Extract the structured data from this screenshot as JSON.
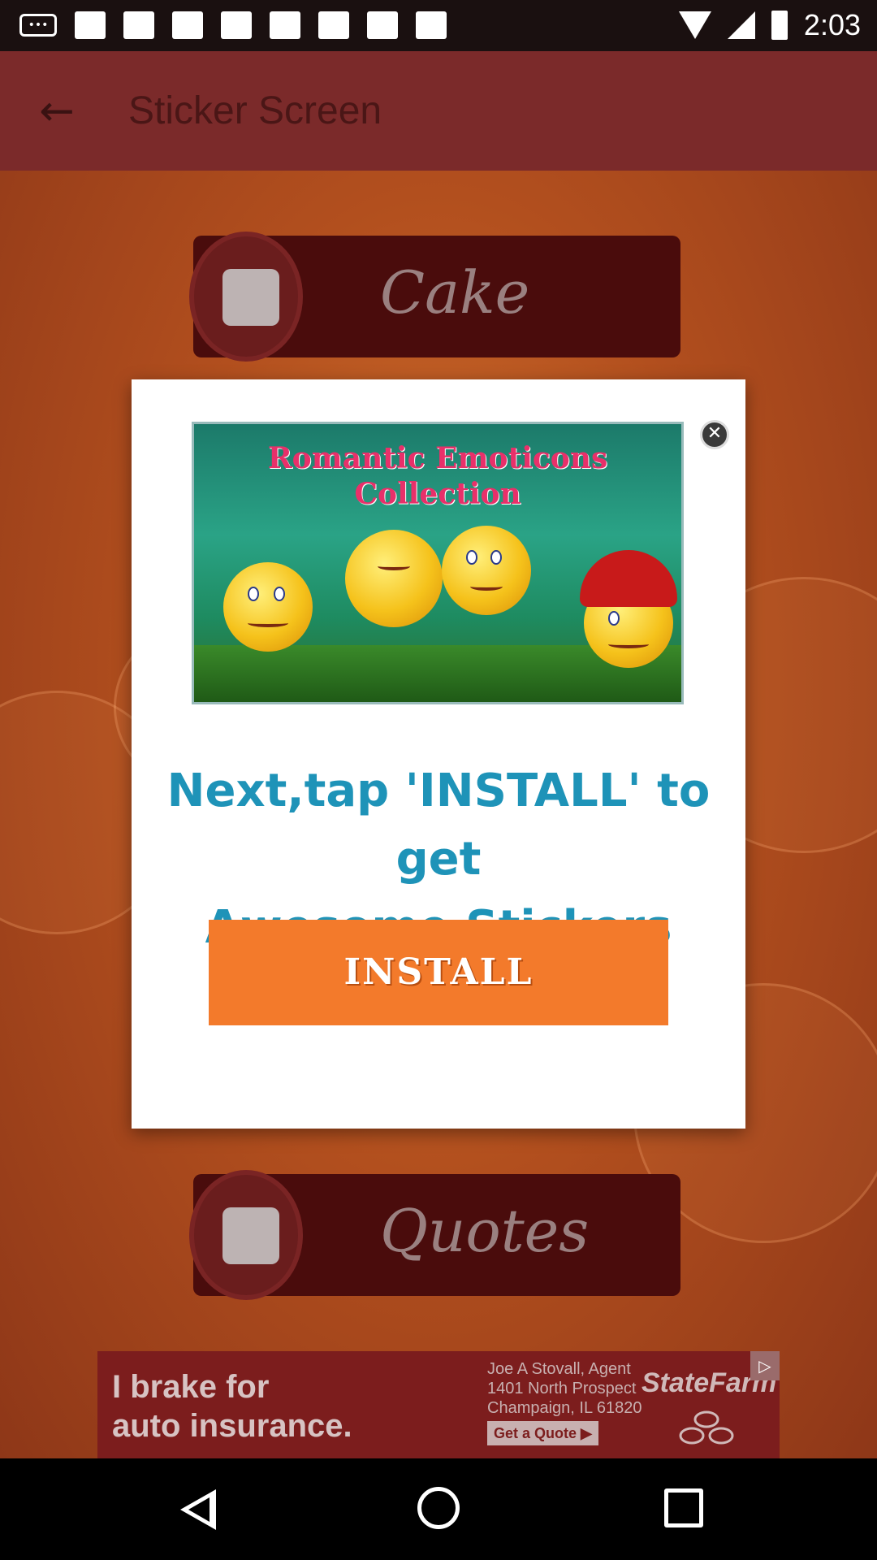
{
  "status_bar": {
    "time": "2:03"
  },
  "app_bar": {
    "title": "Sticker Screen"
  },
  "categories": [
    {
      "label": "Cake"
    },
    {
      "label": "Quotes"
    }
  ],
  "dialog": {
    "promo_title_line1": "Romantic Emoticons",
    "promo_title_line2": "Collection",
    "headline_line1": "Next,tap 'INSTALL' to get",
    "headline_line2": "Awesome Stickers",
    "install_label": "INSTALL"
  },
  "ad": {
    "slogan_line1": "I brake for",
    "slogan_line2": "auto insurance.",
    "agent_line1": "Joe A Stovall, Agent",
    "agent_line2": "1401 North Prospect",
    "agent_line3": "Champaign, IL 61820",
    "cta": "Get a Quote",
    "brand": "StateFarm"
  },
  "colors": {
    "app_bar": "#7b2a2a",
    "install_button": "#f37a2b",
    "headline": "#1e93b8",
    "promo_title": "#e8306a"
  }
}
